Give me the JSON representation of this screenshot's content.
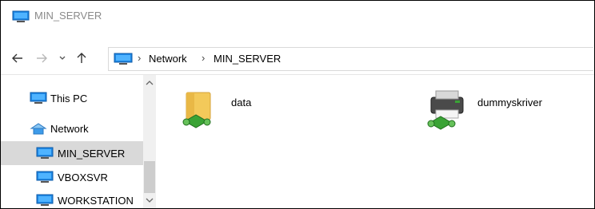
{
  "window": {
    "title": "MIN_SERVER"
  },
  "address_bar": {
    "back_icon": "arrow-left-icon",
    "forward_icon": "arrow-right-icon",
    "recent_icon": "chevron-down-icon",
    "up_icon": "arrow-up-icon",
    "crumbs": [
      "Network",
      "MIN_SERVER"
    ]
  },
  "nav_pane": {
    "items": [
      {
        "label": "This PC",
        "icon": "monitor-icon"
      },
      {
        "label": "Network",
        "icon": "network-icon"
      },
      {
        "label": "MIN_SERVER",
        "icon": "monitor-icon",
        "selected": true
      },
      {
        "label": "VBOXSVR",
        "icon": "monitor-icon"
      },
      {
        "label": "WORKSTATION",
        "icon": "monitor-icon"
      }
    ]
  },
  "content": {
    "items": [
      {
        "name": "data",
        "icon": "shared-folder-icon"
      },
      {
        "name": "dummyskriver",
        "icon": "shared-printer-icon"
      }
    ]
  },
  "colors": {
    "selected_bg": "#d9d9d9",
    "title_text": "#8a8a8a",
    "monitor_blue": "#1e88e5"
  }
}
